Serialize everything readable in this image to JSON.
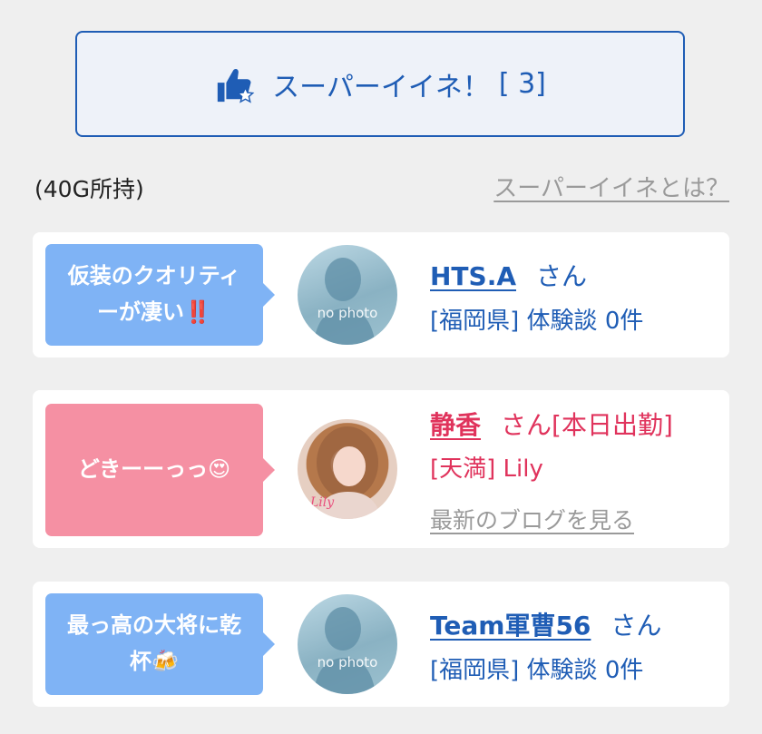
{
  "super_like": {
    "label": "スーパーイイネ！",
    "count_text": "[ 3]"
  },
  "owned_text": "(40G所持)",
  "help_link": "スーパーイイネとは？",
  "colors": {
    "accent": "#1f5db5",
    "red": "#e0335c",
    "bubble_blue": "#7fb3f5",
    "bubble_pink": "#f590a3"
  },
  "cards": [
    {
      "bubble_lines": [
        "仮装のクオリティ",
        "ーが凄い"
      ],
      "bubble_icon": "‼️",
      "avatar_text": "no photo",
      "name": "HTS.A",
      "suffix": "さん",
      "info": "[福岡県] 体験談 0件"
    },
    {
      "bubble_lines": [
        "どきーーっっ"
      ],
      "bubble_icon": "😍",
      "name": "静香",
      "suffix": "さん[本日出勤]",
      "info": "[天満] Lily",
      "blog_link": "最新のブログを見る"
    },
    {
      "bubble_lines": [
        "最っ高の大将に乾",
        "杯"
      ],
      "bubble_icon": "🍻",
      "avatar_text": "no photo",
      "name": "Team軍曹56",
      "suffix": "さん",
      "info": "[福岡県] 体験談 0件"
    }
  ]
}
